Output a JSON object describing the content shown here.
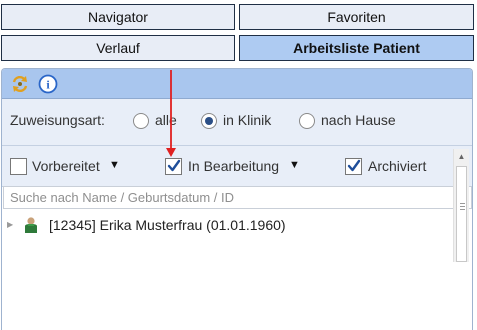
{
  "tabs": {
    "navigator": "Navigator",
    "favoriten": "Favoriten",
    "verlauf": "Verlauf",
    "arbeitsliste": "Arbeitsliste Patient"
  },
  "header": {
    "icons": [
      "refresh-icon",
      "info-icon"
    ],
    "info_glyph": "i"
  },
  "zuweisung": {
    "label": "Zuweisungsart:",
    "options": [
      {
        "label": "alle",
        "selected": false
      },
      {
        "label": "in Klinik",
        "selected": true
      },
      {
        "label": "nach Hause",
        "selected": false
      }
    ]
  },
  "filters": [
    {
      "label": "Vorbereitet",
      "checked": false,
      "dropdown": "▼"
    },
    {
      "label": "In Bearbeitung",
      "checked": true,
      "dropdown": "▼"
    },
    {
      "label": "Archiviert",
      "checked": true
    }
  ],
  "search": {
    "placeholder": "Suche nach Name / Geburtsdatum / ID",
    "value": ""
  },
  "patients": [
    {
      "label": "[12345] Erika Musterfrau (01.01.1960)",
      "icon": "person-icon"
    }
  ],
  "colors": {
    "accent": "#aecbf2",
    "header": "#a9c6ee",
    "filter_bg": "#e8eef8",
    "annotation_arrow": "#e02020"
  }
}
